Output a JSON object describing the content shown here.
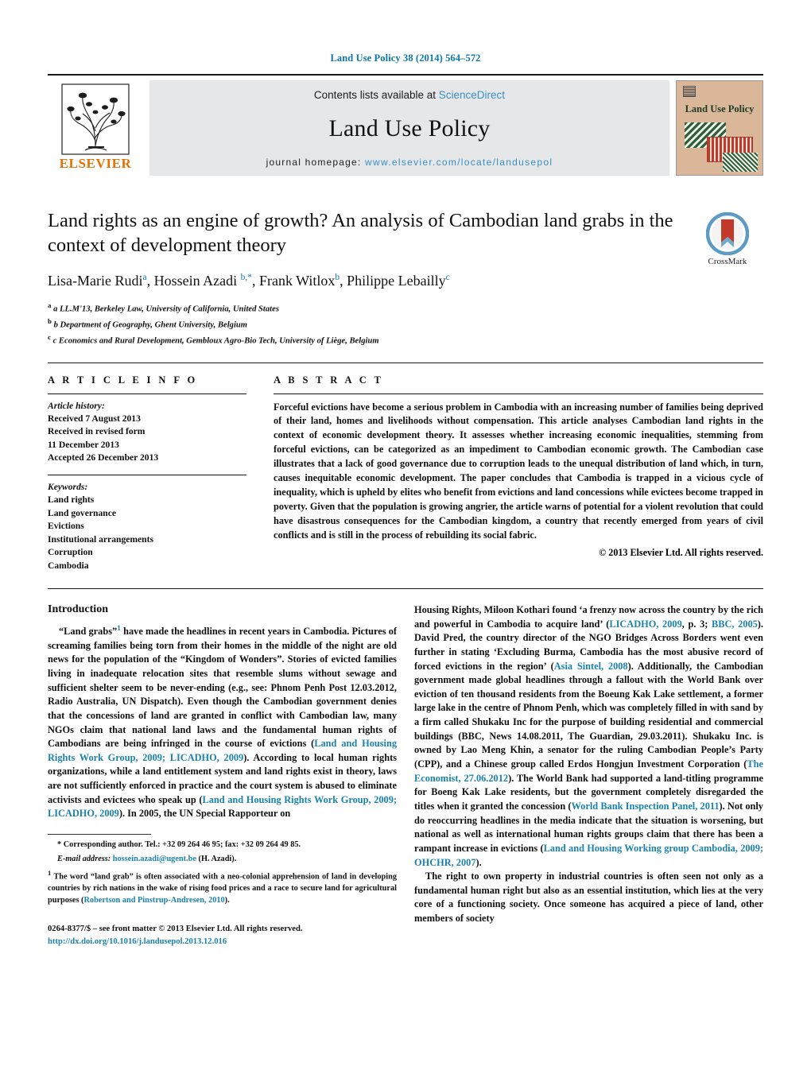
{
  "running_head": "Land Use Policy 38 (2014) 564–572",
  "masthead": {
    "publisher_name": "ELSEVIER",
    "contents_prefix": "Contents lists available at",
    "contents_link": "ScienceDirect",
    "journal_title": "Land Use Policy",
    "homepage_prefix": "journal homepage:",
    "homepage_url": "www.elsevier.com/locate/landusepol",
    "cover_title": "Land Use Policy"
  },
  "crossmark": {
    "label": "CrossMark"
  },
  "article": {
    "title": "Land rights as an engine of growth? An analysis of Cambodian land grabs in the context of development theory",
    "authors_html": "Lisa-Marie Rudi<sup>a</sup>, Hossein Azadi <sup>b,*</sup>, Frank Witlox<sup>b</sup>, Philippe Lebailly<sup>c</sup>",
    "affiliations": [
      "a LL.M'13, Berkeley Law, University of California, United States",
      "b Department of Geography, Ghent University, Belgium",
      "c Economics and Rural Development, Gembloux Agro-Bio Tech, University of Liège, Belgium"
    ]
  },
  "article_info": {
    "heading": "A R T I C L E   I N F O",
    "history_label": "Article history:",
    "history": [
      "Received 7 August 2013",
      "Received in revised form",
      "11 December 2013",
      "Accepted 26 December 2013"
    ],
    "keywords_label": "Keywords:",
    "keywords": [
      "Land rights",
      "Land governance",
      "Evictions",
      "Institutional arrangements",
      "Corruption",
      "Cambodia"
    ]
  },
  "abstract": {
    "heading": "A B S T R A C T",
    "text": "Forceful evictions have become a serious problem in Cambodia with an increasing number of families being deprived of their land, homes and livelihoods without compensation. This article analyses Cambodian land rights in the context of economic development theory. It assesses whether increasing economic inequalities, stemming from forceful evictions, can be categorized as an impediment to Cambodian economic growth. The Cambodian case illustrates that a lack of good governance due to corruption leads to the unequal distribution of land which, in turn, causes inequitable economic development. The paper concludes that Cambodia is trapped in a vicious cycle of inequality, which is upheld by elites who benefit from evictions and land concessions while evictees become trapped in poverty. Given that the population is growing angrier, the article warns of potential for a violent revolution that could have disastrous consequences for the Cambodian kingdom, a country that recently emerged from years of civil conflicts and is still in the process of rebuilding its social fabric.",
    "copyright": "© 2013 Elsevier Ltd. All rights reserved."
  },
  "body": {
    "section_title": "Introduction",
    "left_p1_pre": "“Land grabs”",
    "left_p1_fnmark": "1",
    "left_p1_a": " have made the headlines in recent years in Cambodia. Pictures of screaming families being torn from their homes in the middle of the night are old news for the population of the “Kingdom of Wonders”. Stories of evicted families living in inadequate relocation sites that resemble slums without sewage and sufficient shelter seem to be never-ending (e.g., see: Phnom Penh Post 12.03.2012, Radio Australia, UN Dispatch). Even though the Cambodian government denies that the concessions of land are granted in conflict with Cambodian law, many NGOs claim that national land laws and the fundamental human rights of Cambodians are being infringed in the course of evictions (",
    "left_p1_cite1": "Land and Housing Rights Work Group, 2009; LICADHO, 2009",
    "left_p1_b": "). According to local human rights organizations, while a land entitlement system and land rights exist in theory, laws are not sufficiently enforced in practice and the court system is abused to eliminate activists and evictees who speak up (",
    "left_p1_cite2": "Land and Housing Rights Work Group, 2009; LICADHO, 2009",
    "left_p1_c": "). In 2005, the UN Special Rapporteur on",
    "right_p1_a": "Housing Rights, Miloon Kothari found ‘a frenzy now across the country by the rich and powerful in Cambodia to acquire land’ (",
    "right_cite_licadho": "LICADHO, 2009",
    "right_p1_b": ", p. 3; ",
    "right_cite_bbc": "BBC, 2005",
    "right_p1_c": "). David Pred, the country director of the NGO Bridges Across Borders went even further in stating ‘Excluding Burma, Cambodia has the most abusive record of forced evictions in the region’ (",
    "right_cite_asia": "Asia Sintel, 2008",
    "right_p1_d": "). Additionally, the Cambodian government made global headlines through a fallout with the World Bank over eviction of ten thousand residents from the Boeung Kak Lake settlement, a former large lake in the centre of Phnom Penh, which was completely filled in with sand by a firm called Shukaku Inc for the purpose of building residential and commercial buildings (BBC, News 14.08.2011, The Guardian, 29.03.2011). Shukaku Inc. is owned by Lao Meng Khin, a senator for the ruling Cambodian People’s Party (CPP), and a Chinese group called Erdos Hongjun Investment Corporation (",
    "right_cite_econ": "The Economist, 27.06.2012",
    "right_p1_e": "). The World Bank had supported a land-titling programme for Boeng Kak Lake residents, but the government completely disregarded the titles when it granted the concession (",
    "right_cite_wb": "World Bank Inspection Panel, 2011",
    "right_p1_f": "). Not only do reoccurring headlines in the media indicate that the situation is worsening, but national as well as international human rights groups claim that there has been a rampant increase in evictions (",
    "right_cite_lhw": "Land and Housing Working group Cambodia, 2009; OHCHR, 2007",
    "right_p1_g": ").",
    "right_p2": "The right to own property in industrial countries is often seen not only as a fundamental human right but also as an essential institution, which lies at the very core of a functioning society. Once someone has acquired a piece of land, other members of society"
  },
  "footnotes": {
    "star_marker": "*",
    "star_text": "Corresponding author. Tel.: +32 09 264 46 95; fax: +32 09 264 49 85.",
    "email_label": "E-mail address:",
    "email_value": "hossein.azadi@ugent.be",
    "email_suffix": "(H. Azadi).",
    "one_marker": "1",
    "one_a": "The word “land grab” is often associated with a neo-colonial apprehension of land in developing countries by rich nations in the wake of rising food prices and a race to secure land for agricultural purposes (",
    "one_cite": "Robertson and Pinstrup-Andresen, 2010",
    "one_b": ")."
  },
  "imprint": {
    "line1": "0264-8377/$ – see front matter © 2013 Elsevier Ltd. All rights reserved.",
    "doi": "http://dx.doi.org/10.1016/j.landusepol.2013.12.016"
  },
  "colors": {
    "link": "#1a82ad",
    "running_head": "#0b77a8",
    "elsevier_orange": "#e77000",
    "masthead_bg": "#e6e7e8",
    "cover_bg": "#d9b798",
    "crossmark_red": "#c0392b",
    "crossmark_blue": "#5b9bc4"
  }
}
